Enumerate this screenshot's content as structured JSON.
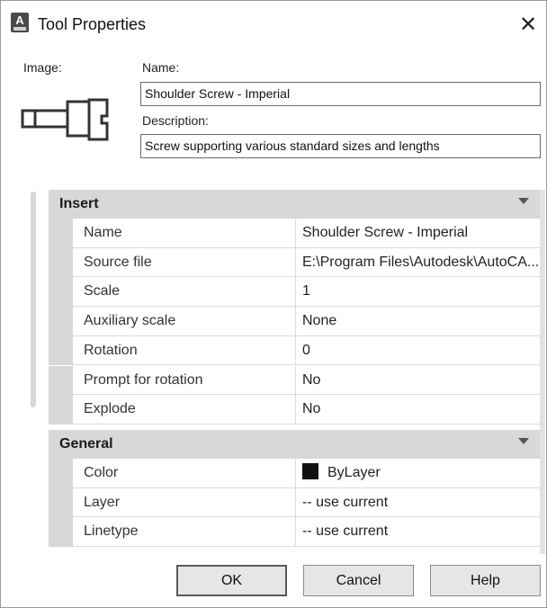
{
  "window": {
    "title": "Tool Properties",
    "app_icon": "autocad-icon",
    "close_glyph": "✕"
  },
  "labels": {
    "image": "Image:",
    "name": "Name:",
    "description": "Description:"
  },
  "fields": {
    "name_value": "Shoulder Screw - Imperial",
    "description_value": "Screw supporting various standard sizes and lengths"
  },
  "preview_icon": "shoulder-screw-icon",
  "sections": [
    {
      "title": "Insert",
      "rows": [
        {
          "prop": "Name",
          "value": "Shoulder Screw - Imperial"
        },
        {
          "prop": "Source file",
          "value": "E:\\Program Files\\Autodesk\\AutoCA..."
        },
        {
          "prop": "Scale",
          "value": "1"
        },
        {
          "prop": "Auxiliary scale",
          "value": "None"
        },
        {
          "prop": "Rotation",
          "value": "0"
        },
        {
          "prop": "Prompt for rotation",
          "value": "No"
        },
        {
          "prop": "Explode",
          "value": "No"
        }
      ]
    },
    {
      "title": "General",
      "rows": [
        {
          "prop": "Color",
          "value": "ByLayer",
          "swatch": "#111111"
        },
        {
          "prop": "Layer",
          "value": "-- use current"
        },
        {
          "prop": "Linetype",
          "value": "-- use current"
        }
      ]
    }
  ],
  "buttons": {
    "ok": "OK",
    "cancel": "Cancel",
    "help": "Help"
  }
}
